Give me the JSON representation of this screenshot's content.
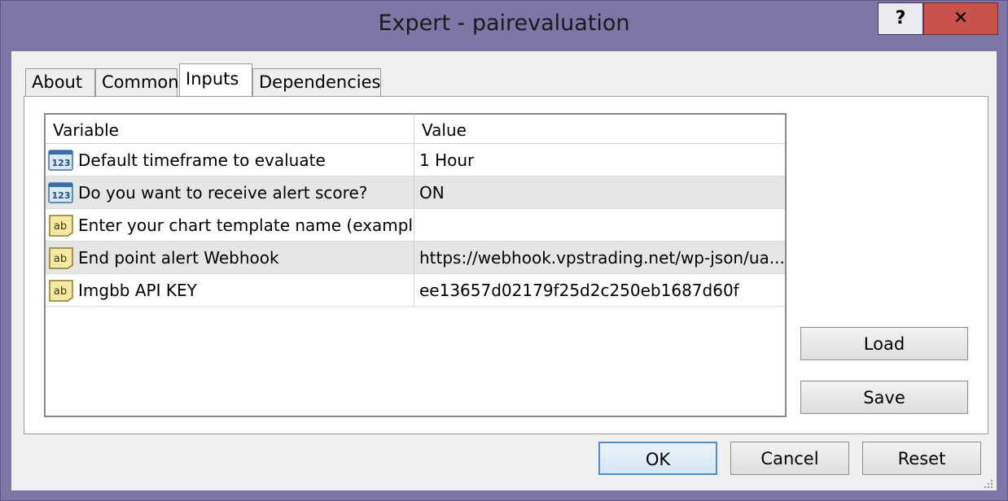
{
  "window": {
    "title": "Expert - pairevaluation",
    "help_label": "?",
    "close_label": "✕"
  },
  "tabs": [
    {
      "label": "About",
      "active": false
    },
    {
      "label": "Common",
      "active": false
    },
    {
      "label": "Inputs",
      "active": true
    },
    {
      "label": "Dependencies",
      "active": false
    }
  ],
  "grid": {
    "headers": {
      "variable": "Variable",
      "value": "Value"
    },
    "rows": [
      {
        "icon": "numeric-123-icon",
        "variable": "Default timeframe to evaluate",
        "value": "1 Hour"
      },
      {
        "icon": "numeric-123-icon",
        "variable": "Do you want to receive alert score?",
        "value": "ON"
      },
      {
        "icon": "string-ab-icon",
        "variable": "Enter your chart template name (example...",
        "value": ""
      },
      {
        "icon": "string-ab-icon",
        "variable": "End point alert Webhook",
        "value": "https://webhook.vpstrading.net/wp-json/ua..."
      },
      {
        "icon": "string-ab-icon",
        "variable": "Imgbb API KEY",
        "value": "ee13657d02179f25d2c250eb1687d60f"
      }
    ]
  },
  "side_buttons": {
    "load": "Load",
    "save": "Save"
  },
  "bottom_buttons": {
    "ok": "OK",
    "cancel": "Cancel",
    "reset": "Reset"
  },
  "colors": {
    "frame": "#7e76a7",
    "close_button": "#c9524a",
    "client": "#f0f0f0",
    "alt_row": "#e6e6e6"
  }
}
